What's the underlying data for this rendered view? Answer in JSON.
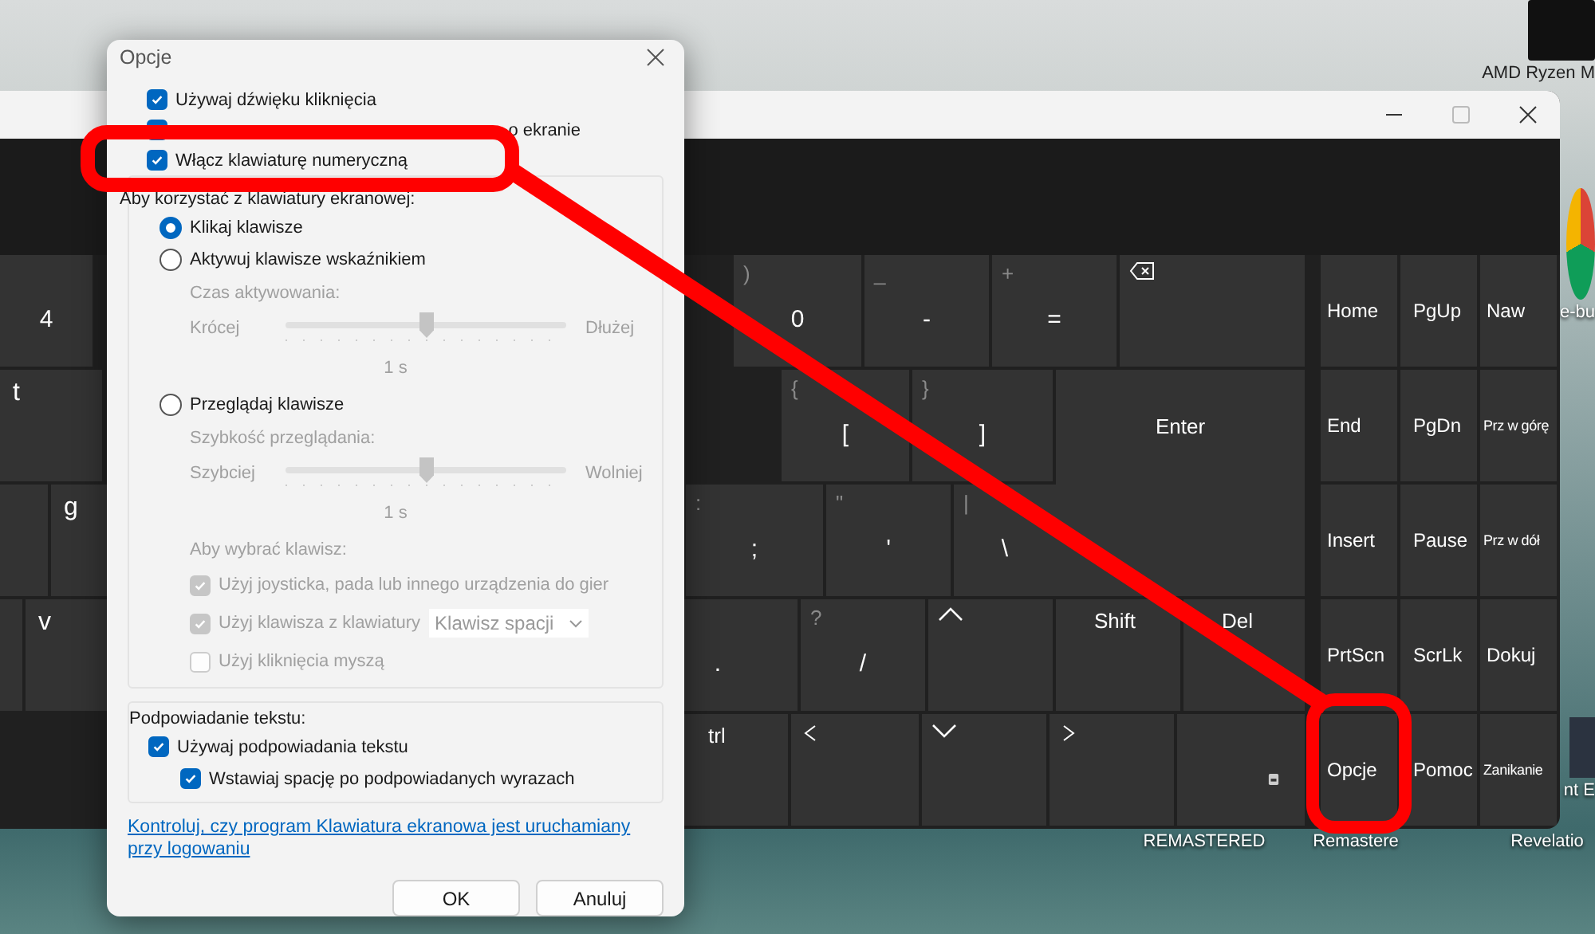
{
  "desktop": {
    "icons": [
      {
        "kind": "ryzen",
        "label": "AMD Ryzen M"
      },
      {
        "kind": "browser",
        "label": "e-bu"
      },
      {
        "kind": "photo",
        "label": "nt E"
      },
      {
        "kind": "text",
        "label": "REMASTERED"
      },
      {
        "kind": "text",
        "label": "Remastere"
      },
      {
        "kind": "text",
        "label": "Revelatio"
      }
    ]
  },
  "keyboard": {
    "main_rows": [
      [
        {
          "kind": "digit",
          "label": "4"
        },
        {
          "kind": "digit",
          "shift": ")",
          "label": "0"
        },
        {
          "kind": "digit",
          "shift": "_",
          "label": "-"
        },
        {
          "kind": "digit",
          "shift": "+",
          "label": "="
        },
        {
          "kind": "backspace"
        }
      ],
      [
        {
          "kind": "letter",
          "label": "t"
        },
        {
          "kind": "digit",
          "shift": "{",
          "label": "["
        },
        {
          "kind": "digit",
          "shift": "}",
          "label": "]"
        },
        {
          "kind": "enter",
          "label": "Enter"
        }
      ],
      [
        {
          "kind": "blank"
        },
        {
          "kind": "letter",
          "label": "g"
        },
        {
          "kind": "digit",
          "shift": ":",
          "label": ";"
        },
        {
          "kind": "digit",
          "shift": "\"",
          "label": "'"
        },
        {
          "kind": "digit",
          "shift": "|",
          "label": "\\"
        }
      ],
      [
        {
          "kind": "blank"
        },
        {
          "kind": "letter",
          "label": "v"
        },
        {
          "kind": "digit",
          "label": "."
        },
        {
          "kind": "digit",
          "shift": "?",
          "label": "/"
        },
        {
          "kind": "up"
        },
        {
          "kind": "fn",
          "label": "Shift"
        },
        {
          "kind": "fn",
          "label": "Del"
        }
      ],
      [
        {
          "kind": "fn",
          "label": "trl"
        },
        {
          "kind": "left"
        },
        {
          "kind": "down"
        },
        {
          "kind": "right"
        },
        {
          "kind": "menu"
        }
      ]
    ],
    "nav_keys": [
      {
        "label": "Home"
      },
      {
        "label": "PgUp"
      },
      {
        "label": "Naw"
      },
      {
        "label": "End"
      },
      {
        "label": "PgDn"
      },
      {
        "label": "Prz w górę",
        "small": true
      },
      {
        "label": "Insert"
      },
      {
        "label": "Pause"
      },
      {
        "label": "Prz w dół",
        "small": true
      },
      {
        "label": "PrtScn"
      },
      {
        "label": "ScrLk"
      },
      {
        "label": "Dokuj"
      },
      {
        "label": "Opcje"
      },
      {
        "label": "Pomoc"
      },
      {
        "label": "Zanikanie",
        "small": true
      }
    ]
  },
  "dialog": {
    "title": "Opcje",
    "options": [
      {
        "kind": "plain",
        "label": "Używaj dźwięku kliknięcia",
        "checked": true
      },
      {
        "kind": "overlaid",
        "label": "o ekranie",
        "checked": true
      },
      {
        "kind": "plain",
        "label": "Włącz klawiaturę numeryczną",
        "checked": true
      }
    ],
    "usage_group": {
      "title": "Aby korzystać z klawiatury ekranowej:",
      "modes": [
        {
          "label": "Klikaj klawisze",
          "selected": true
        },
        {
          "label": "Aktywuj klawisze wskaźnikiem",
          "selected": false,
          "slider": {
            "caption": "Czas aktywowania:",
            "min_label": "Krócej",
            "max_label": "Dłużej",
            "level": 0.5,
            "reading": "1 s",
            "disabled": true
          }
        },
        {
          "label": "Przeglądaj klawisze",
          "selected": false,
          "slider": {
            "caption": "Szybkość przeglądania:",
            "min_label": "Szybciej",
            "max_label": "Wolniej",
            "level": 0.5,
            "reading": "1 s",
            "disabled": true
          }
        }
      ],
      "select_caption": "Aby wybrać klawisz:",
      "select_options": [
        {
          "label": "Użyj joysticka, pada lub innego urządzenia do gier",
          "checked": true,
          "disabled": true
        },
        {
          "label": "Użyj klawisza z klawiatury",
          "checked": true,
          "disabled": true,
          "dropdown": "Klawisz spacji"
        },
        {
          "label": "Użyj kliknięcia myszą",
          "checked": false,
          "disabled": true
        }
      ]
    },
    "prediction_group": {
      "title": "Podpowiadanie tekstu:",
      "options": [
        {
          "label": "Używaj podpowiadania tekstu",
          "checked": true,
          "children": [
            {
              "label": "Wstawiaj spację po podpowiadanych wyrazach",
              "checked": true
            }
          ]
        }
      ]
    },
    "link": "Kontroluj, czy program Klawiatura ekranowa jest uruchamiany przy logowaniu",
    "buttons": [
      "OK",
      "Anuluj"
    ]
  }
}
